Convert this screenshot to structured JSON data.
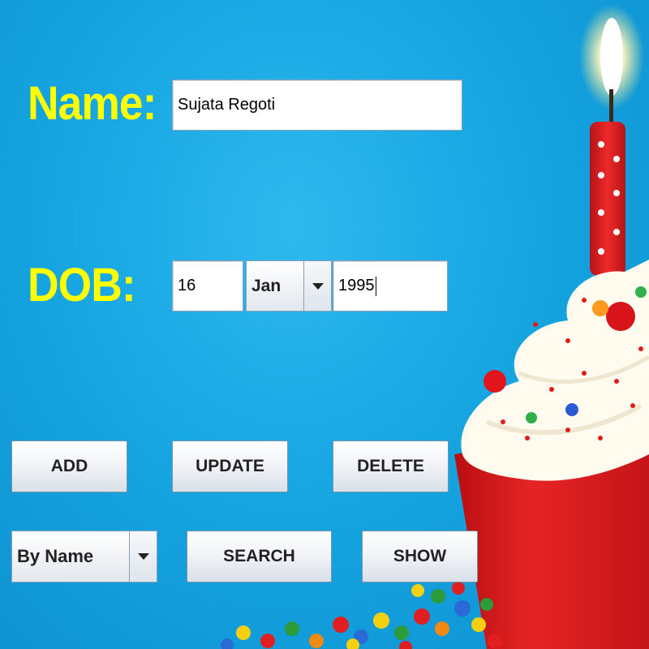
{
  "form": {
    "name_label": "Name:",
    "name_value": "Sujata Regoti",
    "dob_label": "DOB:",
    "dob_day": "16",
    "dob_month": "Jan",
    "dob_year": "1995"
  },
  "buttons": {
    "add": "ADD",
    "update": "UPDATE",
    "delete": "DELETE",
    "search": "SEARCH",
    "show": "SHOW"
  },
  "search": {
    "mode": "By Name"
  },
  "colors": {
    "background": "#16a6e2",
    "label": "#ffff00",
    "frosting": "#fffdf5",
    "cup": "#e51d1d"
  },
  "decoration": {
    "image": "birthday-cupcake-with-candle"
  }
}
